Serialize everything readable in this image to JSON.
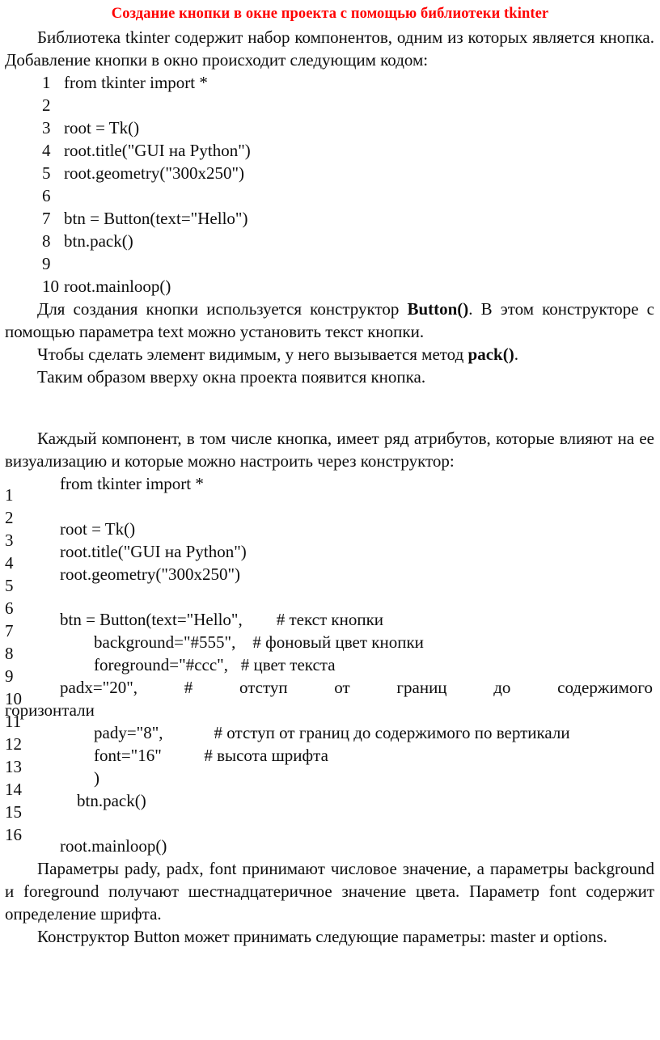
{
  "document": {
    "title": "Создание кнопки в окне проекта с помощью библиотеки tkinter",
    "title_color": "#ff0000"
  },
  "intro": {
    "paragraph": "Библиотека tkinter содержит набор компонентов, одним из которых является кнопка. Добавление кнопки в окно происходит следующим кодом:"
  },
  "code_block_1": {
    "lines": [
      {
        "num": "1",
        "src": "from tkinter import *"
      },
      {
        "num": "2",
        "src": ""
      },
      {
        "num": "3",
        "src": "root = Tk()"
      },
      {
        "num": "4",
        "src": "root.title(\"GUI на Python\")"
      },
      {
        "num": "5",
        "src": "root.geometry(\"300x250\")"
      },
      {
        "num": "6",
        "src": ""
      },
      {
        "num": "7",
        "src": "btn = Button(text=\"Hello\")"
      },
      {
        "num": "8",
        "src": "btn.pack()"
      },
      {
        "num": "9",
        "src": ""
      },
      {
        "num": "10",
        "src": "root.mainloop()"
      }
    ]
  },
  "explain": {
    "p1_a": "Для создания кнопки используется конструктор ",
    "p1_b": "Button()",
    "p1_c": ". В этом конструкторе с помощью параметра text можно установить текст кнопки.",
    "p2_a": "Чтобы сделать элемент видимым, у него вызывается метод ",
    "p2_b": "pack()",
    "p2_c": ".",
    "p3": "Таким образом вверху окна проекта появится кнопка."
  },
  "attributes": {
    "paragraph": "Каждый компонент, в том числе кнопка, имеет ряд атрибутов, которые влияют на ее визуализацию и которые можно настроить через конструктор:"
  },
  "code_block_2": {
    "numbers": [
      "1",
      "2",
      "3",
      "4",
      "5",
      "6",
      "7",
      "8",
      "9",
      "10",
      "11",
      "12",
      "13",
      "14",
      "15",
      "16"
    ],
    "lines": [
      "from tkinter import *",
      "",
      "root = Tk()",
      "root.title(\"GUI на Python\")",
      "root.geometry(\"300x250\")",
      "",
      "btn = Button(text=\"Hello\",        # текст кнопки",
      "        background=\"#555\",    # фоновый цвет кнопки",
      "        foreground=\"#ccc\",   # цвет текста"
    ],
    "padx_line": "padx=\"20\", # отступ от границ до содержимого",
    "padx_wrap": "горизонтали",
    "pady_line": "        pady=\"8\",            # отступ от границ до содержимого по вертикали",
    "font_line": "        font=\"16\"          # высота шрифта",
    "paren_line": "        )",
    "pack_line": "    btn.pack()",
    "blank_line": "",
    "mainloop_line": "root.mainloop()"
  },
  "params": {
    "p1": "Параметры pady, padx, font принимают числовое значение, а параметры background и foreground получают шестнадцатеричное значение цвета. Параметр font содержит определение шрифта.",
    "p2": "Конструктор Button может принимать следующие параметры: master и options."
  }
}
